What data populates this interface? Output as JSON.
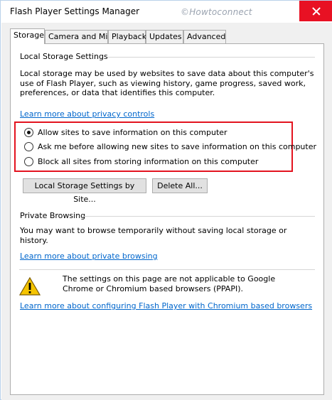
{
  "window": {
    "title": "Flash Player Settings Manager",
    "watermark": "©Howtoconnect"
  },
  "tabs": [
    {
      "label": "Storage",
      "active": true
    },
    {
      "label": "Camera and Mic",
      "active": false
    },
    {
      "label": "Playback",
      "active": false
    },
    {
      "label": "Updates",
      "active": false
    },
    {
      "label": "Advanced",
      "active": false
    }
  ],
  "local_storage": {
    "heading": "Local Storage Settings",
    "description": "Local storage may be used by websites to save data about this computer's use of Flash Player, such as viewing history, game progress, saved work, preferences, or data that identifies this computer.",
    "privacy_link": "Learn more about privacy controls",
    "options": [
      {
        "label": "Allow sites to save information on this computer",
        "selected": true
      },
      {
        "label": "Ask me before allowing new sites to save information on this computer",
        "selected": false
      },
      {
        "label": "Block all sites from storing information on this computer",
        "selected": false
      }
    ],
    "settings_by_site_button": "Local Storage Settings by Site...",
    "delete_all_button": "Delete All..."
  },
  "private_browsing": {
    "heading": "Private Browsing",
    "description": "You may want to browse temporarily without saving local storage or history.",
    "link": "Learn more about private browsing"
  },
  "notice": {
    "icon": "warning-icon",
    "text": "The settings on this page are not applicable to Google Chrome or Chromium based browsers (PPAPI).",
    "link": "Learn more about configuring Flash Player with Chromium based browsers"
  },
  "colors": {
    "link": "#0066cc",
    "highlight": "#e3131f",
    "close": "#e81123"
  }
}
